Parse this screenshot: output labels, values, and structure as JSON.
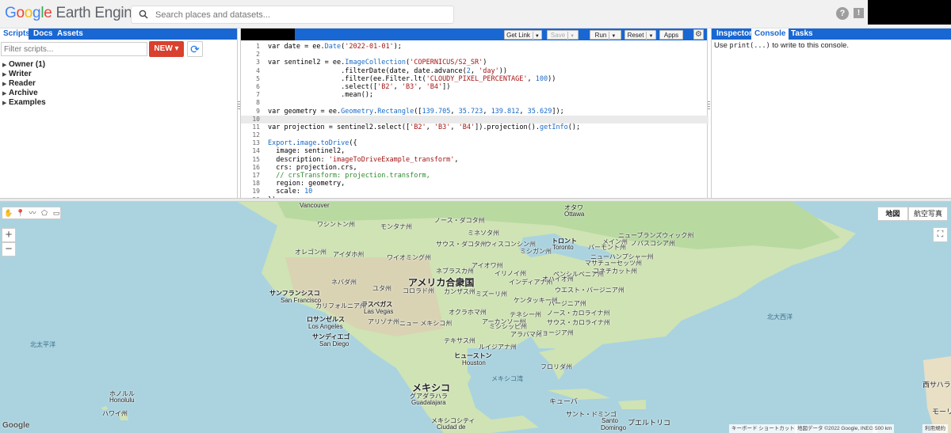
{
  "header": {
    "logo": {
      "g": "G",
      "o1": "o",
      "o2": "o",
      "g2": "g",
      "l": "l",
      "e": "e",
      "product": "Earth Engine"
    },
    "search_placeholder": "Search places and datasets...",
    "help_glyph": "?",
    "feedback_glyph": "!"
  },
  "left_panel": {
    "tabs": [
      "Scripts",
      "Docs",
      "Assets"
    ],
    "filter_placeholder": "Filter scripts...",
    "new_button": "NEW",
    "tree": [
      "Owner (1)",
      "Writer",
      "Reader",
      "Archive",
      "Examples"
    ]
  },
  "editor": {
    "toolbar": {
      "get_link": "Get Link",
      "save": "Save",
      "run": "Run",
      "reset": "Reset",
      "apps": "Apps"
    },
    "line_numbers": [
      "1",
      "2",
      "3",
      "4",
      "5",
      "6",
      "7",
      "8",
      "9",
      "10",
      "11",
      "12",
      "13",
      "14",
      "15",
      "16",
      "17",
      "18",
      "19",
      "20"
    ],
    "active_line": 10,
    "folded_lines": [
      3,
      13
    ]
  },
  "right_panel": {
    "tabs": [
      "Inspector",
      "Console",
      "Tasks"
    ],
    "console_prefix": "Use ",
    "console_code": "print(...)",
    "console_suffix": " to write to this console."
  },
  "map": {
    "map_types": [
      "地図",
      "航空写真"
    ],
    "zoom_in": "+",
    "zoom_out": "−",
    "google": "Google",
    "attribution": {
      "shortcuts": "キーボード ショートカット",
      "data": "地図データ ©2022 Google, INEGI",
      "scale": "500 km",
      "terms": "利用規約"
    },
    "labels": {
      "usa": "アメリカ合衆国",
      "mexico": "メキシコ",
      "north_pacific": "北太平洋",
      "north_atlantic": "北大西洋",
      "mexico_gulf": "メキシコ湾",
      "cuba": "キューバ",
      "san_francisco_jp": "サンフランシスコ",
      "san_francisco": "San Francisco",
      "las_vegas_jp": "ラスベガス",
      "las_vegas": "Las Vegas",
      "los_angeles_jp": "ロサンゼルス",
      "los_angeles": "Los Angeles",
      "san_diego_jp": "サンディエゴ",
      "san_diego": "San Diego",
      "houston_jp": "ヒューストン",
      "houston": "Houston",
      "guadalajara_jp": "グアダラハラ",
      "guadalajara": "Guadalajara",
      "mexico_city_jp": "メキシコシティ",
      "mexico_city": "Ciudad de",
      "honolulu_jp": "ホノルル",
      "honolulu": "Honolulu",
      "hawaii": "ハワイ州",
      "ottawa_jp": "オタワ",
      "ottawa": "Ottawa",
      "toronto_jp": "トロント",
      "toronto": "Toronto",
      "santo_domingo_jp": "サント・ドミンゴ",
      "santo_domingo": "Santo",
      "domingo": "Domingo",
      "puerto_rico": "プエルトリコ",
      "west_sahara": "西サハラ",
      "morocco": "モーリ",
      "washington": "ワシントン州",
      "montana": "モンタナ州",
      "oregon": "オレゴン州",
      "idaho": "アイダホ州",
      "wyoming": "ワイオミング州",
      "nevada": "ネバダ州",
      "utah": "ユタ州",
      "colorado": "コロラド州",
      "california": "カリフォルニア州",
      "arizona": "アリゾナ州",
      "new_mexico": "ニュー メキシコ州",
      "texas": "テキサス州",
      "oklahoma": "オクラホマ州",
      "kansas": "カンザス州",
      "nebraska": "ネブラスカ州",
      "south_dakota": "サウス・ダコタ州",
      "north_dakota": "ノース・ダコタ州",
      "minnesota": "ミネソタ州",
      "iowa": "アイオワ州",
      "missouri": "ミズーリ州",
      "arkansas": "アーカンソー州",
      "louisiana": "ルイジアナ州",
      "mississippi": "ミシシッピ州",
      "alabama": "アラバマ州",
      "georgia": "ジョージア州",
      "florida": "フロリダ州",
      "tennessee": "テネシー州",
      "kentucky": "ケンタッキー州",
      "illinois": "イリノイ州",
      "indiana": "インディアナ州",
      "ohio": "オハイオ州",
      "michigan": "ミシガン州",
      "wisconsin": "ウィスコンシン州",
      "pennsylvania": "ペンシルベニア州",
      "virginia": "バージニア州",
      "west_virginia": "ウエスト・バージニア州",
      "north_carolina": "ノース・カロライナ州",
      "south_carolina": "サウス・カロライナ州",
      "maine": "メイン州",
      "vermont": "バーモント州",
      "new_hampshire": "ニューハンプシャー州",
      "massachusetts": "マサチューセッツ州",
      "connecticut": "コネチカット州",
      "nova_scotia": "ノバスコシア州",
      "new_brunswick": "ニューブランズウィック州",
      "vancouver": "Vancouver"
    }
  },
  "colors": {
    "brand_blue": "#1967d2",
    "new_red": "#d9402e",
    "water": "#aad3df",
    "land": "#cfe3b4"
  }
}
